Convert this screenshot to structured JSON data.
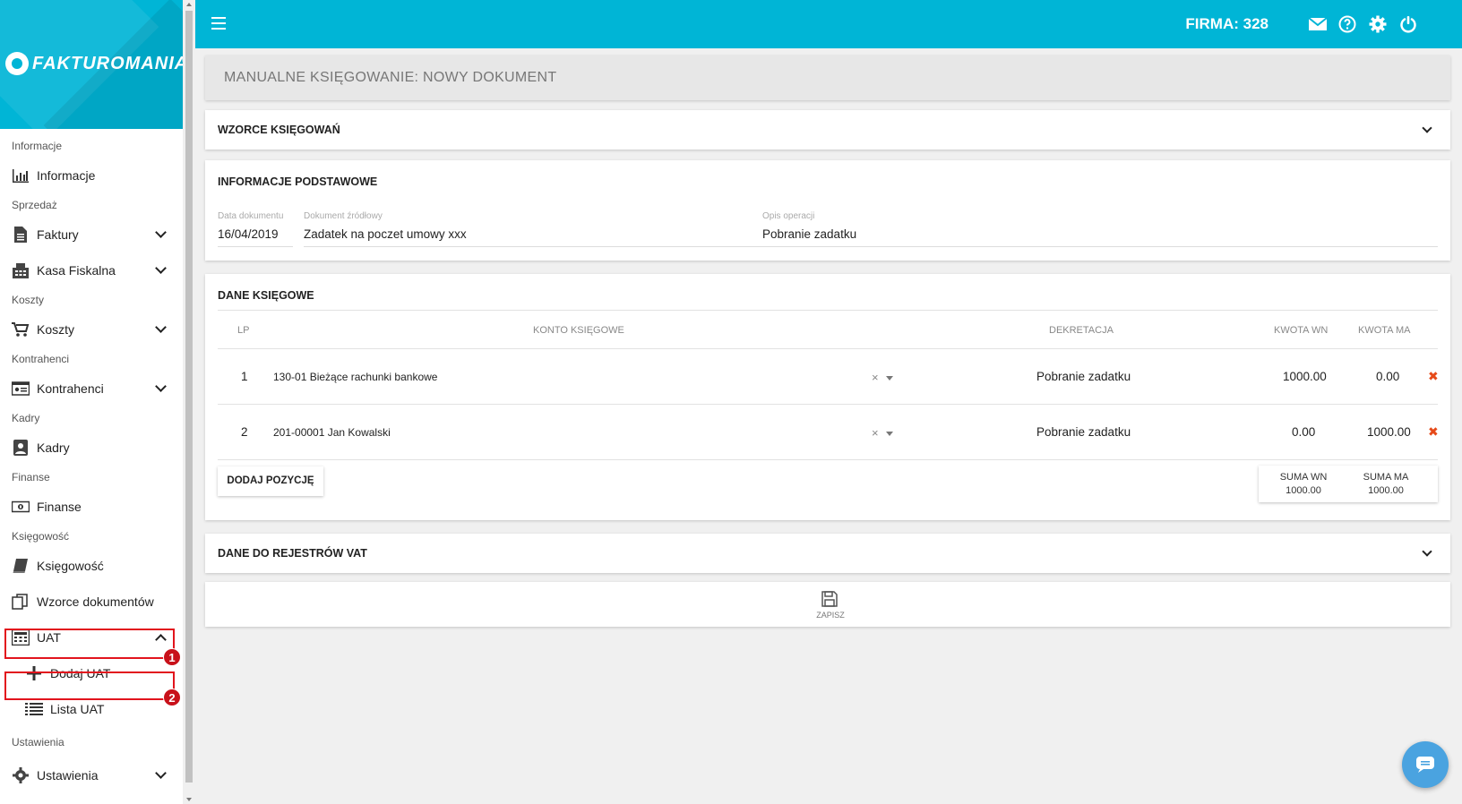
{
  "app": {
    "logo_text": "FAKTUROMANIA",
    "firma_label": "FIRMA: 328"
  },
  "sidebar": {
    "sections": {
      "informacje": "Informacje",
      "sprzedaz": "Sprzedaż",
      "koszty": "Koszty",
      "kontrahenci": "Kontrahenci",
      "kadry": "Kadry",
      "finanse": "Finanse",
      "ksiegowosc": "Księgowość",
      "ustawienia": "Ustawienia"
    },
    "items": {
      "informacje": "Informacje",
      "faktury": "Faktury",
      "kasa_fiskalna": "Kasa Fiskalna",
      "koszty": "Koszty",
      "kontrahenci": "Kontrahenci",
      "kadry": "Kadry",
      "finanse": "Finanse",
      "ksiegowosc": "Księgowość",
      "wzorce_dokumentow": "Wzorce dokumentów",
      "uat": "UAT",
      "dodaj_uat": "Dodaj UAT",
      "lista_uat": "Lista UAT",
      "ustawienia": "Ustawienia"
    },
    "badges": [
      "1",
      "2"
    ]
  },
  "page": {
    "title": "MANUALNE KSIĘGOWANIE: NOWY DOKUMENT",
    "wzorce_header": "WZORCE KSIĘGOWAŃ",
    "info_header": "INFORMACJE PODSTAWOWE",
    "fields": {
      "data_label": "Data dokumentu",
      "data_value": "16/04/2019",
      "dokument_label": "Dokument źródłowy",
      "dokument_value": "Zadatek na poczet umowy xxx",
      "opis_label": "Opis operacji",
      "opis_value": "Pobranie zadatku"
    },
    "dane_header": "DANE KSIĘGOWE",
    "table": {
      "headers": [
        "LP",
        "KONTO KSIĘGOWE",
        "DEKRETACJA",
        "KWOTA WN",
        "KWOTA MA"
      ],
      "rows": [
        {
          "lp": "1",
          "konto": "130-01 Bieżące rachunki bankowe",
          "dekretacja": "Pobranie zadatku",
          "wn": "1000.00",
          "ma": "0.00"
        },
        {
          "lp": "2",
          "konto": "201-00001 Jan Kowalski",
          "dekretacja": "Pobranie zadatku",
          "wn": "0.00",
          "ma": "1000.00"
        }
      ],
      "clear_symbol": "×",
      "delete_symbol": "✖"
    },
    "add_button": "DODAJ POZYCJĘ",
    "sums": {
      "wn_label": "SUMA WN",
      "wn_value": "1000.00",
      "ma_label": "SUMA MA",
      "ma_value": "1000.00"
    },
    "vat_header": "DANE DO REJESTRÓW VAT",
    "save_label": "ZAPISZ"
  },
  "colors": {
    "accent": "#00b5d6",
    "highlight": "#e2141d",
    "delete": "#e64a19",
    "chat": "#4aa3e0"
  }
}
